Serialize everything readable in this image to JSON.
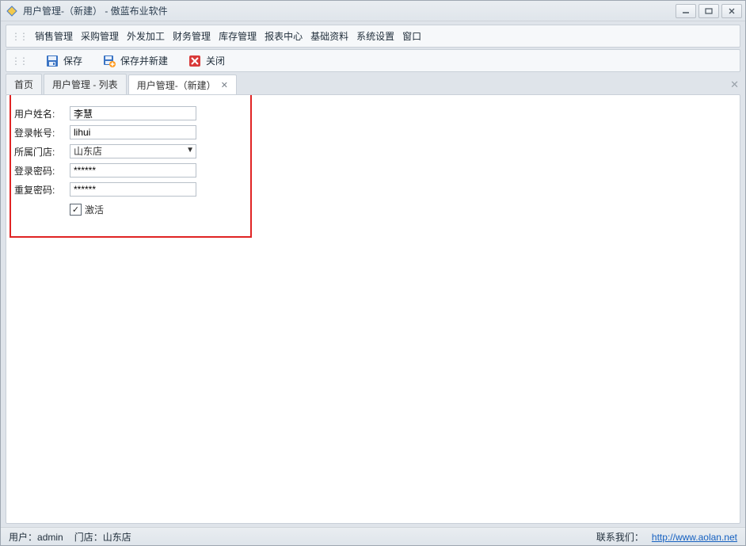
{
  "window": {
    "title": "用户管理-（新建） - 傲蓝布业软件"
  },
  "menu": {
    "items": [
      "销售管理",
      "采购管理",
      "外发加工",
      "财务管理",
      "库存管理",
      "报表中心",
      "基础资料",
      "系统设置",
      "窗口"
    ]
  },
  "toolbar": {
    "save": "保存",
    "save_and_new": "保存并新建",
    "close": "关闭"
  },
  "tabs": {
    "items": [
      {
        "label": "首页",
        "active": false,
        "closable": false
      },
      {
        "label": "用户管理 - 列表",
        "active": false,
        "closable": false
      },
      {
        "label": "用户管理-（新建）",
        "active": true,
        "closable": true
      }
    ]
  },
  "form": {
    "labels": {
      "username": "用户姓名:",
      "login": "登录帐号:",
      "store": "所属门店:",
      "password": "登录密码:",
      "repeat": "重复密码:",
      "active": "激活"
    },
    "values": {
      "username": "李慧",
      "login": "lihui",
      "store": "山东店",
      "password": "******",
      "repeat": "******",
      "active_checked": true
    }
  },
  "status": {
    "user_label": "用户：",
    "user_value": "admin",
    "store_label": "门店：",
    "store_value": "山东店",
    "contact_label": "联系我们：",
    "contact_url": "http://www.aolan.net"
  }
}
